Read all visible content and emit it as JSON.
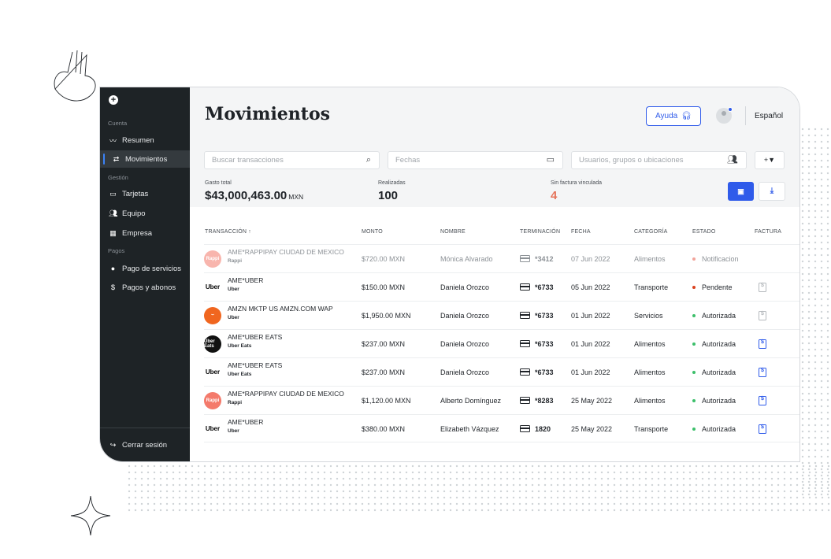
{
  "colors": {
    "accent": "#2f5bea",
    "sidebar_bg": "#1e2326",
    "warning": "#e5735a",
    "status_authorized": "#3cbf6a",
    "status_pending": "#d9411e",
    "status_notification": "#f2a39a"
  },
  "sidebar": {
    "logo_icon": "plus-circle-icon",
    "sections": {
      "cuenta": "Cuenta",
      "gestion": "Gestión",
      "pagos": "Pagos"
    },
    "items": [
      {
        "label": "Resumen",
        "icon": "pulse-icon"
      },
      {
        "label": "Movimientos",
        "icon": "transfer-icon",
        "active": true
      },
      {
        "label": "Tarjetas",
        "icon": "card-icon"
      },
      {
        "label": "Equipo",
        "icon": "users-icon"
      },
      {
        "label": "Empresa",
        "icon": "building-icon"
      },
      {
        "label": "Pago de servicios",
        "icon": "bulb-icon"
      },
      {
        "label": "Pagos y abonos",
        "icon": "dollar-icon"
      }
    ],
    "logout": "Cerrar sesión"
  },
  "header": {
    "title": "Movimientos",
    "help_label": "Ayuda",
    "language": "Español"
  },
  "filters": {
    "search_placeholder": "Buscar transacciones",
    "dates_placeholder": "Fechas",
    "users_placeholder": "Usuarios, grupos o ubicaciones",
    "filter_label": "+▼"
  },
  "stats": {
    "total_label": "Gasto total",
    "total_value": "$43,000,463.00",
    "total_unit": "MXN",
    "done_label": "Realizadas",
    "done_value": "100",
    "noinvoice_label": "Sin factura vinculada",
    "noinvoice_value": "4"
  },
  "table": {
    "headers": [
      "TRANSACCIÓN ↑",
      "MONTO",
      "NOMBRE",
      "TERMINACIÓN",
      "FECHA",
      "CATEGORÍA",
      "ESTADO",
      "FACTURA"
    ],
    "rows": [
      {
        "merchant": "AME*RAPPIPAY CIUDAD DE MEXICO",
        "sub": "Rappi",
        "logo": "Rappi",
        "amount": "$720.00 MXN",
        "name": "Mónica Alvarado",
        "term": "*3412",
        "date": "07 Jun 2022",
        "category": "Alimentos",
        "status": "Notificacion",
        "invoice": ""
      },
      {
        "merchant": "AME*UBER",
        "sub": "Uber",
        "logo": "Uber",
        "amount": "$150.00 MXN",
        "name": "Daniela Orozco",
        "term": "*6733",
        "date": "05 Jun 2022",
        "category": "Transporte",
        "status": "Pendente",
        "invoice": "grey"
      },
      {
        "merchant": "AMZN MKTP US AMZN.COM WAP",
        "sub": "Uber",
        "logo": "",
        "amount": "$1,950.00 MXN",
        "name": "Daniela Orozco",
        "term": "*6733",
        "date": "01 Jun 2022",
        "category": "Servicios",
        "status": "Autorizada",
        "invoice": "grey"
      },
      {
        "merchant": "AME*UBER EATS",
        "sub": "Uber Eats",
        "logo": "Uber Eats",
        "amount": "$237.00 MXN",
        "name": "Daniela Orozco",
        "term": "*6733",
        "date": "01 Jun 2022",
        "category": "Alimentos",
        "status": "Autorizada",
        "invoice": "blue"
      },
      {
        "merchant": "AME*UBER EATS",
        "sub": "Uber Eats",
        "logo": "Uber",
        "amount": "$237.00 MXN",
        "name": "Daniela Orozco",
        "term": "*6733",
        "date": "01 Jun 2022",
        "category": "Alimentos",
        "status": "Autorizada",
        "invoice": "blue"
      },
      {
        "merchant": "AME*RAPPIPAY CIUDAD DE MEXICO",
        "sub": "Rappi",
        "logo": "Rappi",
        "amount": "$1,120.00 MXN",
        "name": "Alberto Domínguez",
        "term": "*8283",
        "date": "25 May 2022",
        "category": "Alimentos",
        "status": "Autorizada",
        "invoice": "blue"
      },
      {
        "merchant": "AME*UBER",
        "sub": "Uber",
        "logo": "Uber",
        "amount": "$380.00 MXN",
        "name": "Elizabeth Vázquez",
        "term": "1820",
        "date": "25 May 2022",
        "category": "Transporte",
        "status": "Autorizada",
        "invoice": "blue"
      }
    ]
  }
}
